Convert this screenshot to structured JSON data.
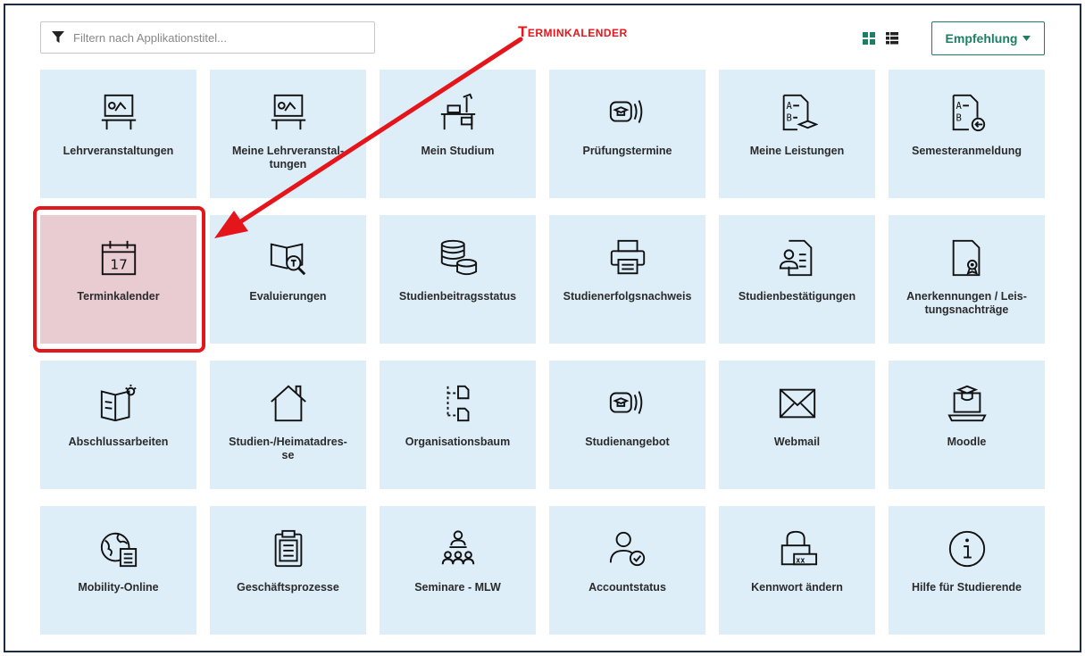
{
  "filter": {
    "placeholder": "Filtern nach Applikationstitel..."
  },
  "annotation": {
    "label": "Terminkalender"
  },
  "sort_button": {
    "label": "Empfehlung"
  },
  "colors": {
    "tile": "#deeef9",
    "selected_tile": "#e9cbd2",
    "accent": "#1a7f65",
    "annotation": "#e5161b"
  },
  "tiles": [
    {
      "label": "Lehrveranstaltungen",
      "icon": "presentation-board-icon"
    },
    {
      "label": "Meine Lehrveranstal-\ntungen",
      "icon": "presentation-board-icon"
    },
    {
      "label": "Mein Studium",
      "icon": "study-desk-icon"
    },
    {
      "label": "Prüfungstermine",
      "icon": "graduation-broadcast-icon"
    },
    {
      "label": "Meine Leistungen",
      "icon": "grades-document-icon"
    },
    {
      "label": "Semesteranmeldung",
      "icon": "grades-signin-icon"
    },
    {
      "label": "Terminkalender",
      "icon": "calendar-icon"
    },
    {
      "label": "Evaluierungen",
      "icon": "book-search-icon"
    },
    {
      "label": "Studienbeitragsstatus",
      "icon": "coins-icon"
    },
    {
      "label": "Studienerfolgsnachweis",
      "icon": "printer-icon"
    },
    {
      "label": "Studienbestätigungen",
      "icon": "certificate-person-icon"
    },
    {
      "label": "Anerkennungen / Leis-\ntungsnachträge",
      "icon": "document-seal-icon"
    },
    {
      "label": "Abschlussarbeiten",
      "icon": "book-idea-icon"
    },
    {
      "label": "Studien-/Heimatadres-\nse",
      "icon": "home-icon"
    },
    {
      "label": "Organisationsbaum",
      "icon": "org-tree-icon"
    },
    {
      "label": "Studienangebot",
      "icon": "graduation-broadcast-icon"
    },
    {
      "label": "Webmail",
      "icon": "envelope-icon"
    },
    {
      "label": "Moodle",
      "icon": "laptop-graduation-icon"
    },
    {
      "label": "Mobility-Online",
      "icon": "globe-document-icon"
    },
    {
      "label": "Geschäftsprozesse",
      "icon": "clipboard-icon"
    },
    {
      "label": "Seminare - MLW",
      "icon": "seminar-group-icon"
    },
    {
      "label": "Accountstatus",
      "icon": "user-check-icon"
    },
    {
      "label": "Kennwort ändern",
      "icon": "lock-password-icon"
    },
    {
      "label": "Hilfe für Studierende",
      "icon": "info-icon"
    }
  ]
}
